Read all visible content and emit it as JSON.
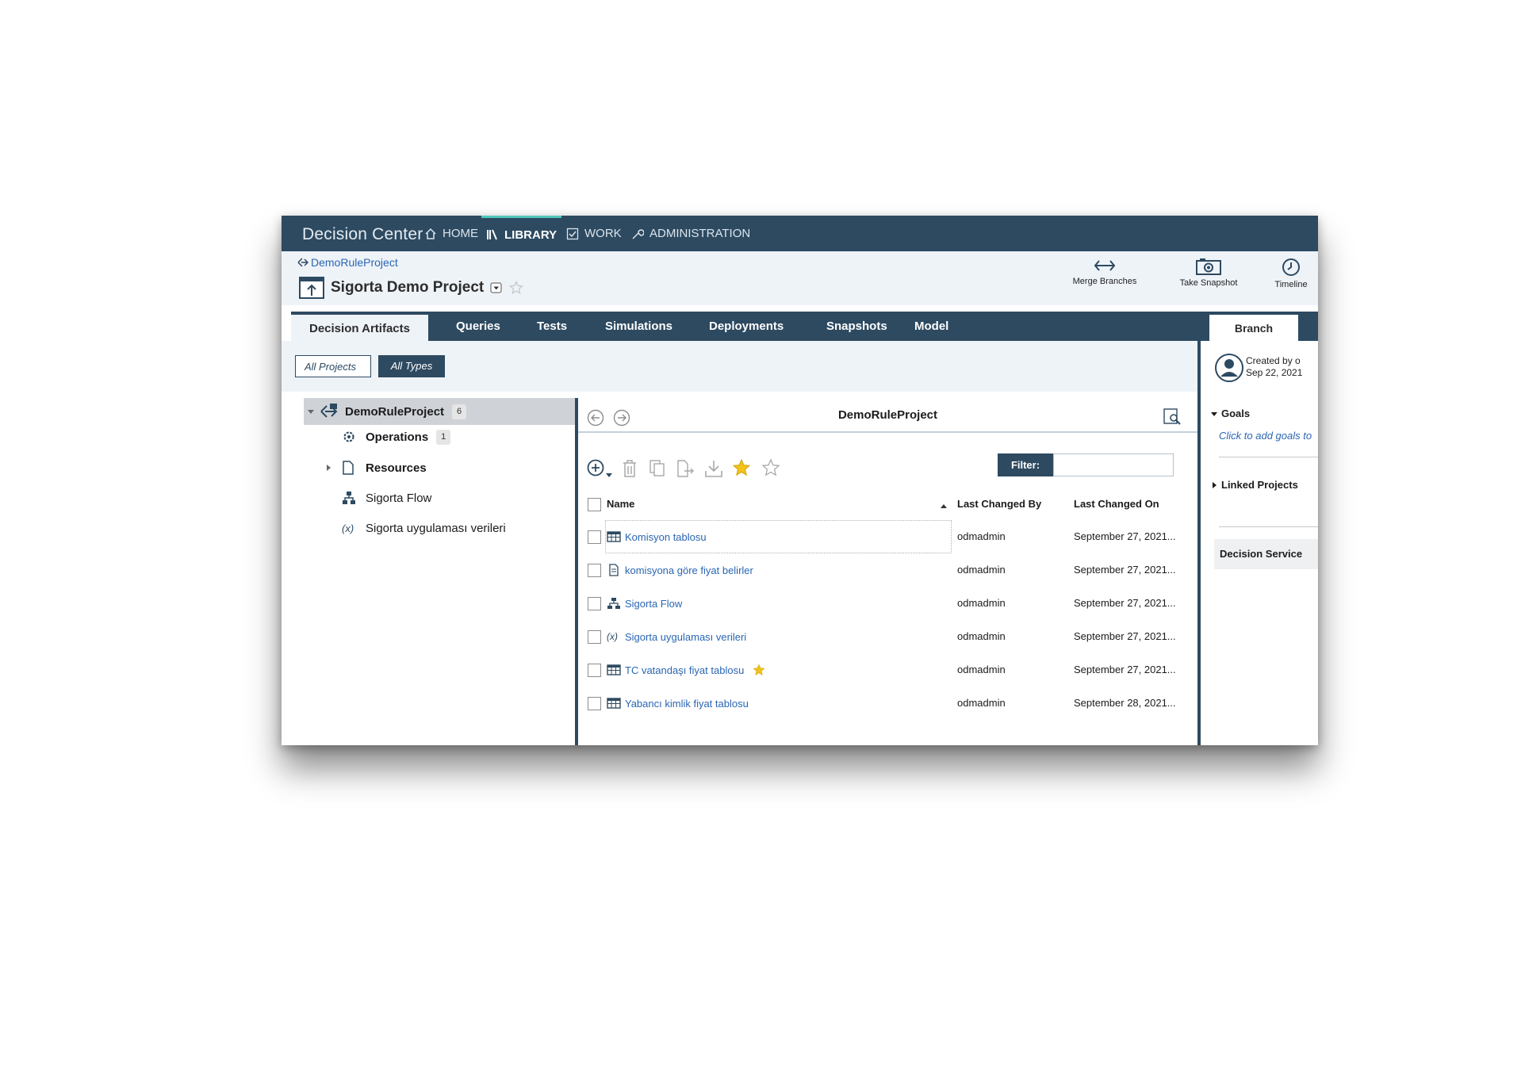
{
  "app": {
    "brand": "Decision Center"
  },
  "nav": [
    {
      "label": "HOME",
      "icon": "home-icon"
    },
    {
      "label": "LIBRARY",
      "icon": "library-icon"
    },
    {
      "label": "WORK",
      "icon": "checkbox-icon"
    },
    {
      "label": "ADMINISTRATION",
      "icon": "wrench-icon"
    }
  ],
  "header": {
    "breadcrumb": "DemoRuleProject",
    "project_title": "Sigorta Demo Project",
    "actions": [
      {
        "label": "Merge Branches",
        "icon": "merge-arrows-icon"
      },
      {
        "label": "Take Snapshot",
        "icon": "camera-icon"
      },
      {
        "label": "Timeline",
        "icon": "clock-icon"
      }
    ]
  },
  "tabs": [
    "Decision Artifacts",
    "Queries",
    "Tests",
    "Simulations",
    "Deployments",
    "Snapshots",
    "Model"
  ],
  "active_tab": "Decision Artifacts",
  "side_tab": "Branch",
  "filters": {
    "all_projects": "All Projects",
    "all_types": "All Types"
  },
  "tree": {
    "root": {
      "label": "DemoRuleProject",
      "count": "6"
    },
    "items": [
      {
        "label": "Operations",
        "count": "1",
        "icon": "gear-icon",
        "bold": true
      },
      {
        "label": "Resources",
        "icon": "document-icon",
        "bold": true
      },
      {
        "label": "Sigorta Flow",
        "icon": "flow-icon",
        "bold": false
      },
      {
        "label": "Sigorta uygulaması verileri",
        "icon": "variable-icon",
        "bold": false
      }
    ]
  },
  "main": {
    "title": "DemoRuleProject",
    "filter_label": "Filter:",
    "filter_value": "",
    "columns": {
      "name": "Name",
      "by": "Last Changed By",
      "on": "Last Changed On"
    },
    "rows": [
      {
        "name": "Komisyon tablosu",
        "icon": "table-icon",
        "by": "odmadmin",
        "on": "September 27, 2021...",
        "starred": false
      },
      {
        "name": "komisyona göre fiyat belirler",
        "icon": "document-icon",
        "by": "odmadmin",
        "on": "September 27, 2021...",
        "starred": false
      },
      {
        "name": "Sigorta Flow",
        "icon": "flow-icon",
        "by": "odmadmin",
        "on": "September 27, 2021...",
        "starred": false
      },
      {
        "name": "Sigorta uygulaması verileri",
        "icon": "variable-icon",
        "by": "odmadmin",
        "on": "September 27, 2021...",
        "starred": false
      },
      {
        "name": "TC vatandaşı fiyat tablosu",
        "icon": "table-icon",
        "by": "odmadmin",
        "on": "September 27, 2021...",
        "starred": true
      },
      {
        "name": "Yabancı kimlik fiyat tablosu",
        "icon": "table-icon",
        "by": "odmadmin",
        "on": "September 28, 2021...",
        "starred": false
      }
    ]
  },
  "right_panel": {
    "created_line1": "Created by o",
    "created_line2": "Sep 22, 2021",
    "goals": "Goals",
    "goals_link": "Click to add goals to",
    "linked": "Linked Projects",
    "decision_service": "Decision Service"
  },
  "colors": {
    "navy": "#2d4a61",
    "accent": "#4fc6b9",
    "link": "#2a66b3",
    "star": "#f1c21b"
  }
}
